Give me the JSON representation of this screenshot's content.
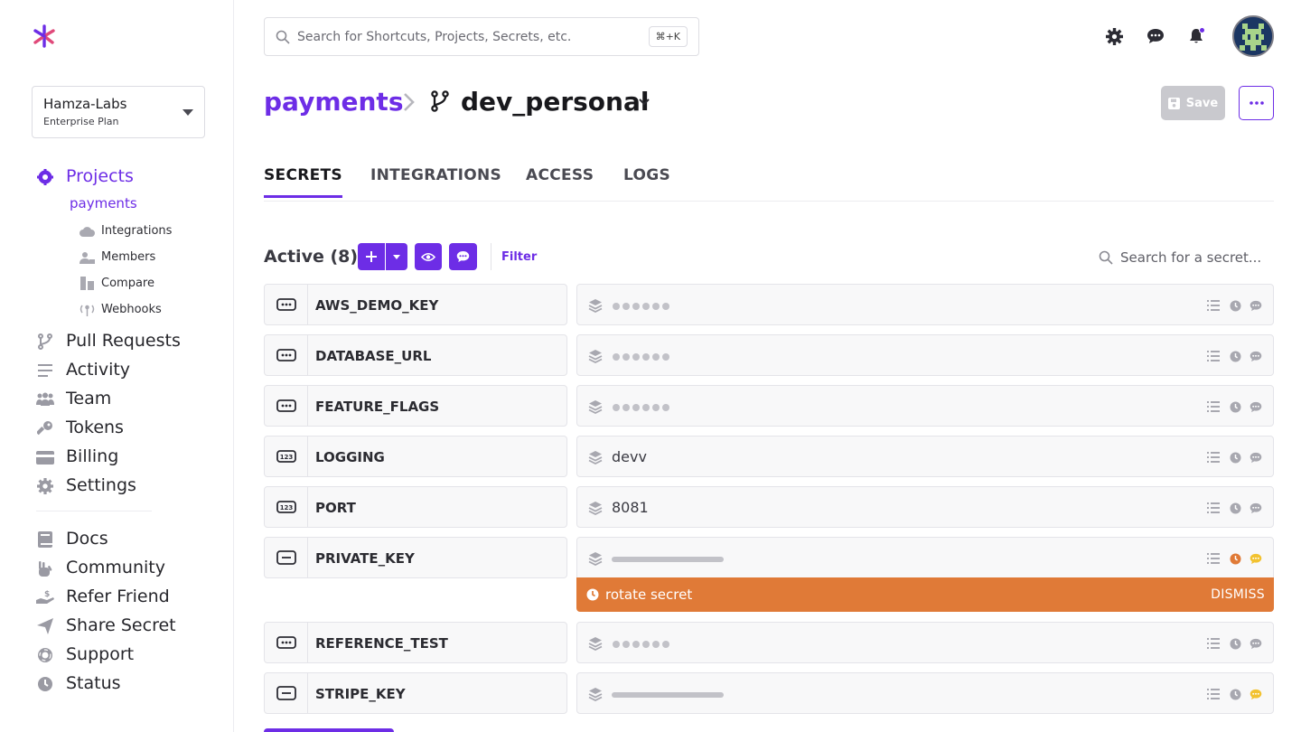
{
  "app": {
    "brand_color": "#6d2de6",
    "warning_color": "#e07a37"
  },
  "org": {
    "name": "Hamza-Labs",
    "plan": "Enterprise Plan"
  },
  "sidebar": {
    "projects_label": "Projects",
    "current_project": "payments",
    "sub_items": [
      {
        "label": "Integrations",
        "icon": "cloud-icon"
      },
      {
        "label": "Members",
        "icon": "members-icon"
      },
      {
        "label": "Compare",
        "icon": "compare-icon"
      },
      {
        "label": "Webhooks",
        "icon": "webhook-icon"
      }
    ],
    "items": [
      {
        "label": "Pull Requests",
        "icon": "pull-request-icon"
      },
      {
        "label": "Activity",
        "icon": "activity-icon"
      },
      {
        "label": "Team",
        "icon": "team-icon"
      },
      {
        "label": "Tokens",
        "icon": "key-icon"
      },
      {
        "label": "Billing",
        "icon": "billing-icon"
      },
      {
        "label": "Settings",
        "icon": "gear-icon"
      }
    ],
    "secondary_items": [
      {
        "label": "Docs",
        "icon": "book-icon"
      },
      {
        "label": "Community",
        "icon": "community-icon"
      },
      {
        "label": "Refer Friend",
        "icon": "refer-icon"
      },
      {
        "label": "Share Secret",
        "icon": "send-icon"
      },
      {
        "label": "Support",
        "icon": "support-icon"
      },
      {
        "label": "Status",
        "icon": "clock-icon"
      }
    ]
  },
  "topbar": {
    "search_placeholder": "Search for Shortcuts, Projects, Secrets, etc.",
    "shortcut": "⌘+K"
  },
  "header": {
    "project": "payments",
    "branch": "dev_personal",
    "save_label": "Save"
  },
  "tabs": [
    {
      "label": "SECRETS",
      "active": true
    },
    {
      "label": "INTEGRATIONS",
      "active": false
    },
    {
      "label": "ACCESS",
      "active": false
    },
    {
      "label": "LOGS",
      "active": false
    }
  ],
  "secrets_toolbar": {
    "active_label": "Active (8)",
    "filter_label": "Filter",
    "search_placeholder": "Search for a secret..."
  },
  "secrets": [
    {
      "key": "AWS_DEMO_KEY",
      "type": "string",
      "value": "",
      "display": "masked"
    },
    {
      "key": "DATABASE_URL",
      "type": "string",
      "value": "",
      "display": "masked"
    },
    {
      "key": "FEATURE_FLAGS",
      "type": "string",
      "value": "",
      "display": "masked"
    },
    {
      "key": "LOGGING",
      "type": "number",
      "value": "devv",
      "display": "plain"
    },
    {
      "key": "PORT",
      "type": "number",
      "value": "8081",
      "display": "plain"
    },
    {
      "key": "PRIVATE_KEY",
      "type": "multiline",
      "value": "",
      "display": "bar",
      "warning": true
    },
    {
      "key": "REFERENCE_TEST",
      "type": "string",
      "value": "",
      "display": "masked"
    },
    {
      "key": "STRIPE_KEY",
      "type": "multiline",
      "value": "",
      "display": "bar",
      "note": true
    }
  ],
  "banner": {
    "text": "rotate secret",
    "dismiss": "DISMISS"
  }
}
